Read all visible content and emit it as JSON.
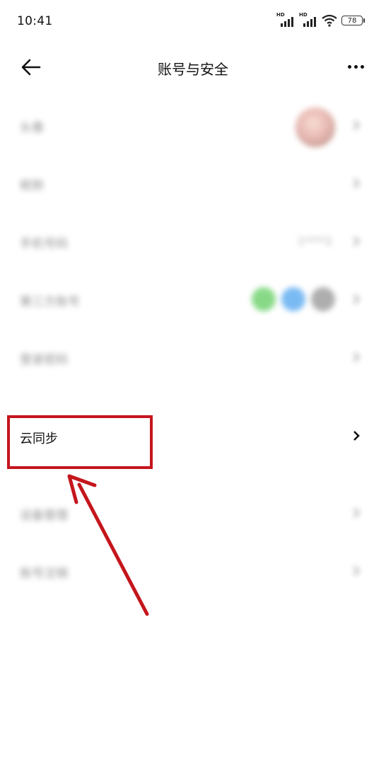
{
  "status_bar": {
    "time": "10:41",
    "hd1": "HD",
    "hd2": "HD",
    "battery": "78"
  },
  "header": {
    "title": "账号与安全"
  },
  "rows": [
    {
      "label": "头像"
    },
    {
      "label": "昵称"
    },
    {
      "label": "手机号码",
      "value": "1****2"
    },
    {
      "label": "第三方账号"
    },
    {
      "label": "登录密码"
    }
  ],
  "cloud_sync": {
    "label": "云同步"
  },
  "rows_after": [
    {
      "label": "设备管理"
    },
    {
      "label": "账号注销"
    }
  ],
  "third_party_colors": [
    "#6bd06a",
    "#5aa9f0",
    "#9a9a9a"
  ],
  "highlight_color": "#c4161c"
}
